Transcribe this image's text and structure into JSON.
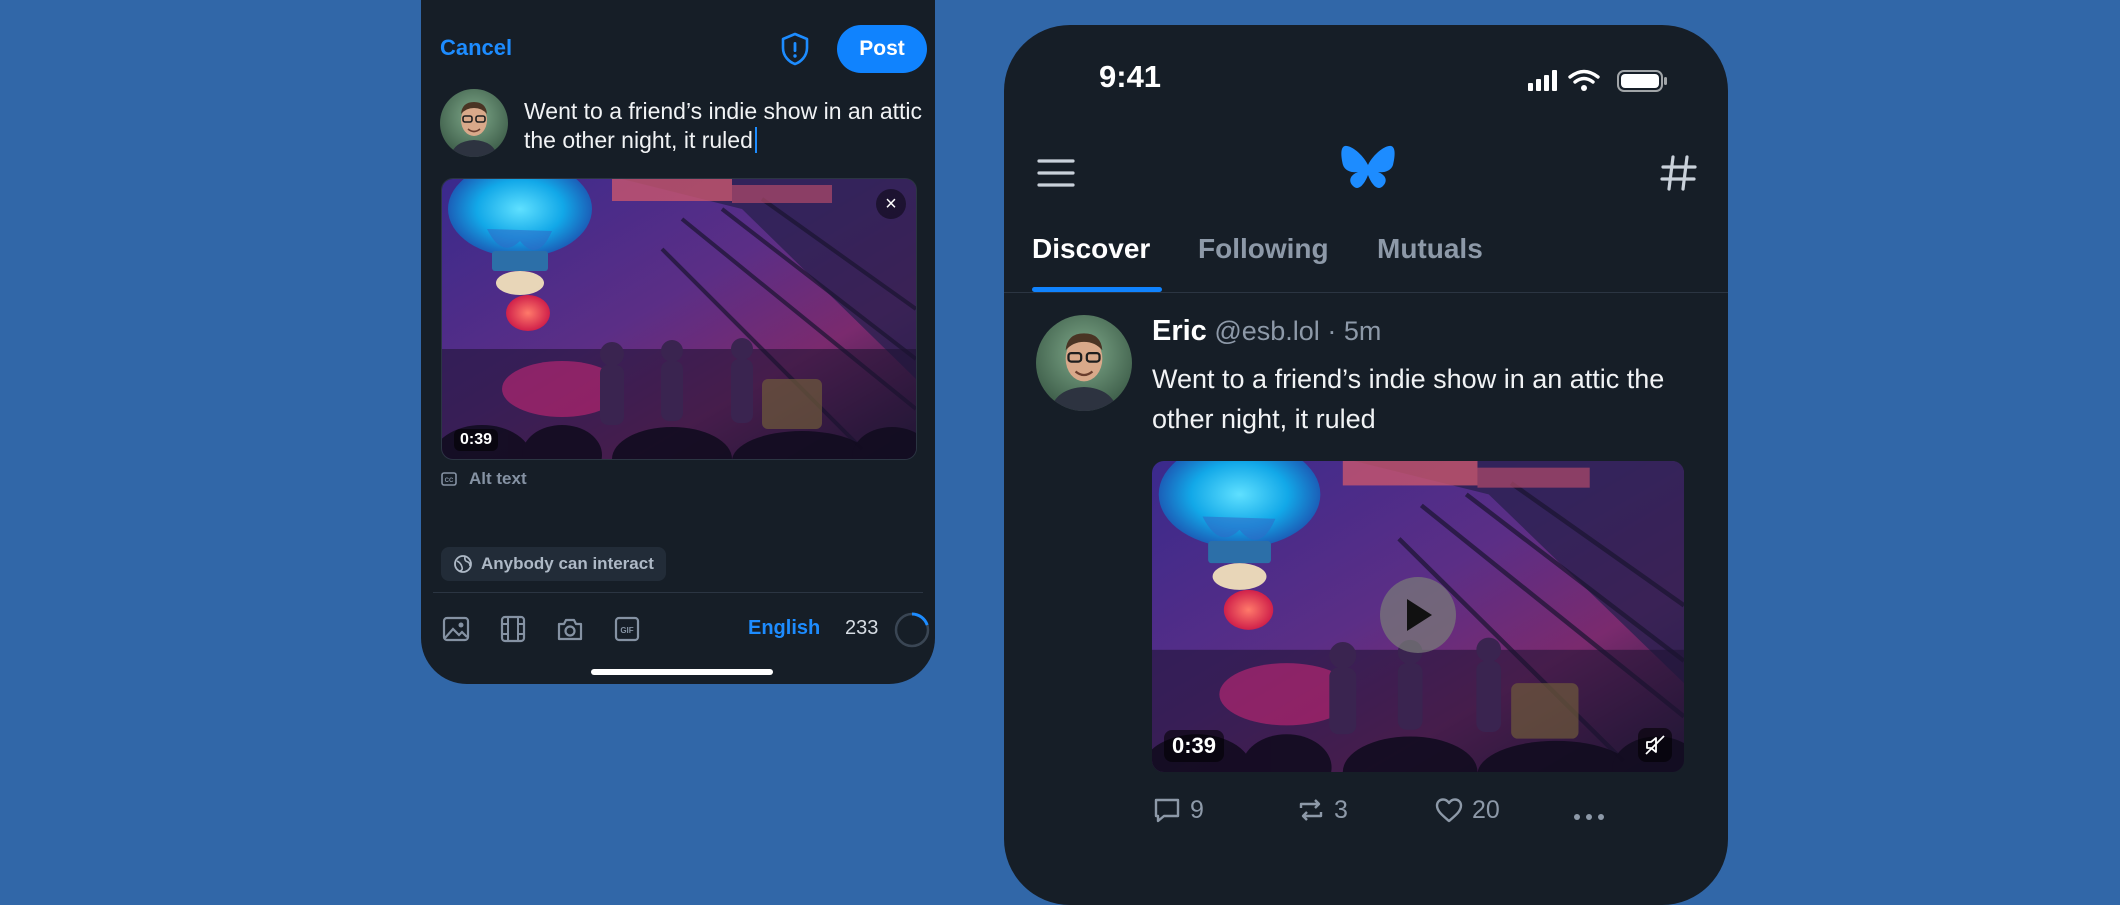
{
  "composer": {
    "cancel_label": "Cancel",
    "post_label": "Post",
    "draft_text": "Went to a friend’s indie show in an attic the other night, it ruled",
    "video_duration": "0:39",
    "alt_text_label": "Alt text",
    "interaction_label": "Anybody can interact",
    "language": "English",
    "chars_remaining": "233"
  },
  "feed": {
    "status_time": "9:41",
    "tabs": [
      {
        "label": "Discover",
        "active": true
      },
      {
        "label": "Following",
        "active": false
      },
      {
        "label": "Mutuals",
        "active": false
      }
    ],
    "post": {
      "author_name": "Eric",
      "handle": "@esb.lol",
      "separator": "·",
      "time": "5m",
      "text": "Went to a friend’s indie show in an attic the other night, it ruled",
      "video_duration": "0:39",
      "replies": "9",
      "reposts": "3",
      "likes": "20"
    }
  },
  "colors": {
    "background": "#3167A8",
    "panel": "#161E27",
    "accent": "#1083FE",
    "muted_text": "#8D99A8"
  }
}
